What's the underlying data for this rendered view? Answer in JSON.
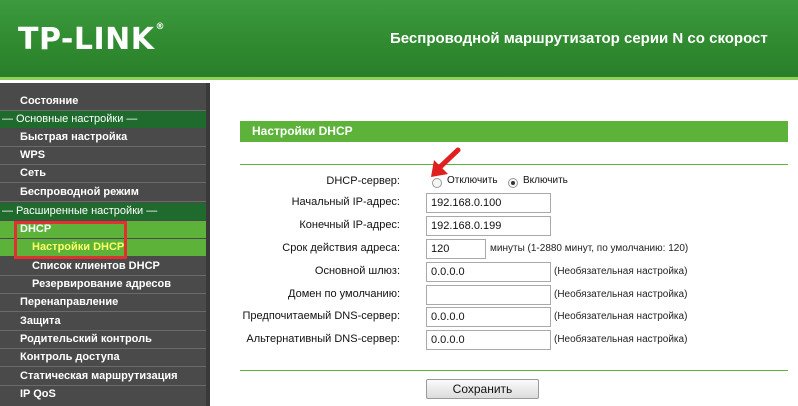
{
  "header": {
    "logo": "TP-LINK",
    "logo_mark": "®",
    "banner": "Беспроводной маршрутизатор серии N со скорост"
  },
  "sidebar": {
    "items": [
      {
        "label": "Состояние"
      },
      {
        "label": "— Основные настройки —"
      },
      {
        "label": "Быстрая настройка"
      },
      {
        "label": "WPS"
      },
      {
        "label": "Сеть"
      },
      {
        "label": "Беспроводной режим"
      },
      {
        "label": "— Расширенные настройки —"
      },
      {
        "label": "DHCP"
      },
      {
        "label": "Настройки DHCP"
      },
      {
        "label": "Список клиентов DHCP"
      },
      {
        "label": "Резервирование адресов"
      },
      {
        "label": "Перенаправление"
      },
      {
        "label": "Защита"
      },
      {
        "label": "Родительский контроль"
      },
      {
        "label": "Контроль доступа"
      },
      {
        "label": "Статическая маршрутизация"
      },
      {
        "label": "IP QoS"
      }
    ]
  },
  "main": {
    "section_title": "Настройки DHCP",
    "dhcp_server": {
      "label": "DHCP-сервер:",
      "off_label": "Отключить",
      "on_label": "Включить",
      "selected": "Включить"
    },
    "start_ip": {
      "label": "Начальный IP-адрес:",
      "value": "192.168.0.100"
    },
    "end_ip": {
      "label": "Конечный IP-адрес:",
      "value": "192.168.0.199"
    },
    "lease": {
      "label": "Срок действия адреса:",
      "value": "120",
      "hint": "минуты (1-2880 минут, по умолчанию: 120)"
    },
    "gateway": {
      "label": "Основной шлюз:",
      "value": "0.0.0.0",
      "hint": "(Необязательная настройка)"
    },
    "domain": {
      "label": "Домен по умолчанию:",
      "value": "",
      "hint": "(Необязательная настройка)"
    },
    "dns1": {
      "label": "Предпочитаемый DNS-сервер:",
      "value": "0.0.0.0",
      "hint": "(Необязательная настройка)"
    },
    "dns2": {
      "label": "Альтернативный DNS-сервер:",
      "value": "0.0.0.0",
      "hint": "(Необязательная настройка)"
    },
    "save_label": "Сохранить"
  },
  "colors": {
    "brand_green": "#2f8a2f",
    "accent_green": "#5db33a",
    "highlight_red": "#e03030"
  }
}
